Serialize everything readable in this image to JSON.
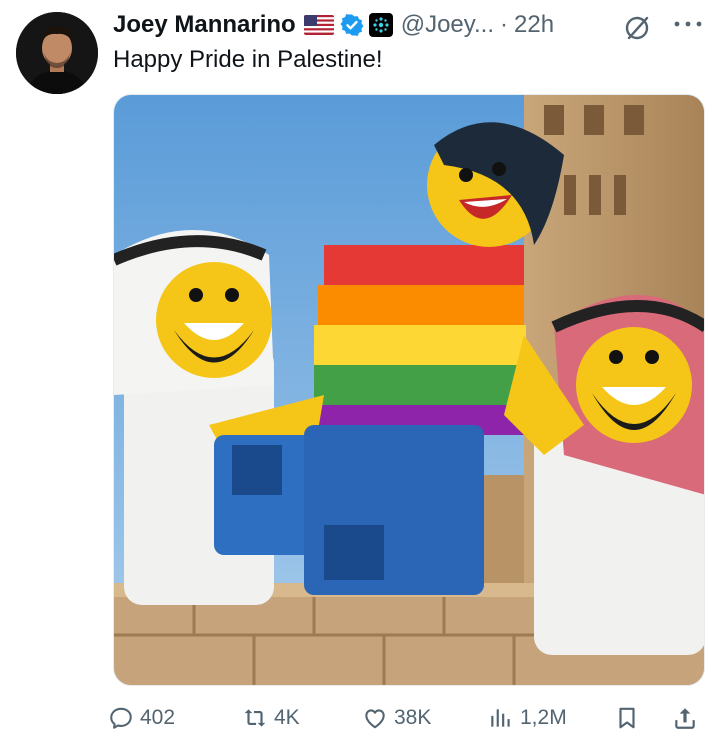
{
  "tweet": {
    "author_name": "Joey Mannarino",
    "handle": "@Joey...",
    "separator": "·",
    "time": "22h",
    "text": "Happy Pride in Palestine!",
    "badges": [
      "us-flag-icon",
      "verified-badge-icon",
      "affiliate-badge-icon"
    ]
  },
  "actions": {
    "replies": "402",
    "reposts": "4K",
    "likes": "38K",
    "views": "1,2M"
  },
  "colors": {
    "text_primary": "#0f1419",
    "text_secondary": "#536471",
    "verified_blue": "#1d9bf0"
  }
}
